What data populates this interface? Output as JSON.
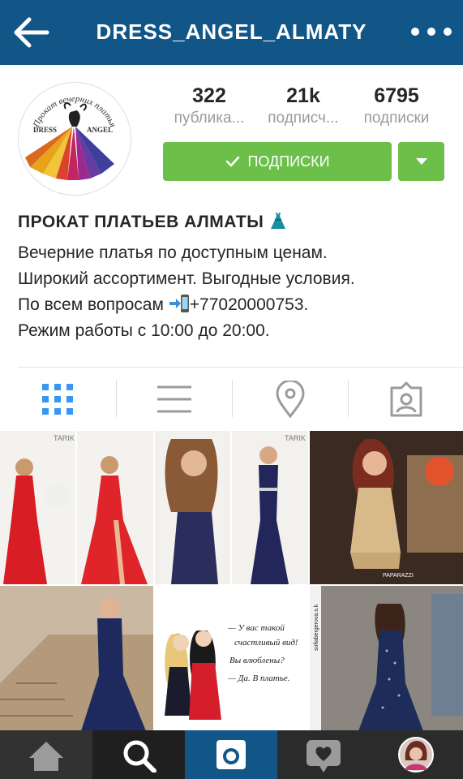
{
  "header": {
    "username": "DRESS_ANGEL_ALMATY",
    "back_icon": "back-arrow-icon",
    "more_icon": "more-dots-icon",
    "bg_color": "#125688"
  },
  "profile": {
    "avatar_text_top": "Прокат вечерних платья",
    "avatar_logo_left": "DRESS",
    "avatar_logo_right": "ANGEL",
    "stats": [
      {
        "value": "322",
        "label": "публика..."
      },
      {
        "value": "21k",
        "label": "подписч..."
      },
      {
        "value": "6795",
        "label": "подписки"
      }
    ],
    "follow_button": "ПОДПИСКИ",
    "accent_color": "#6cc04a"
  },
  "bio": {
    "name": "ПРОКАТ ПЛАТЬЕВ АЛМАТЫ",
    "line1": "Вечерние платья по доступным ценам.",
    "line2": "Широкий ассортимент. Выгодные условия.",
    "line3_prefix": "По всем вопросам ",
    "line3_phone": "+77020000753.",
    "line4": "Режим работы с 10:00 до 20:00."
  },
  "tabs": [
    "grid-icon",
    "list-icon",
    "location-pin-icon",
    "tagged-person-icon"
  ],
  "posts": {
    "watermark1": "TARIK",
    "watermark2": "TARIK",
    "paparazzi": "PAPARAZZI",
    "quote_lines": [
      "— У вас такой",
      "счастливый вид!",
      "Вы влюблены?",
      "— Да. В платье."
    ],
    "side_username": "sofiabergerova.s.k"
  },
  "bottom_nav": [
    "home-icon",
    "search-icon",
    "camera-icon",
    "activity-heart-icon",
    "profile-avatar-icon"
  ]
}
